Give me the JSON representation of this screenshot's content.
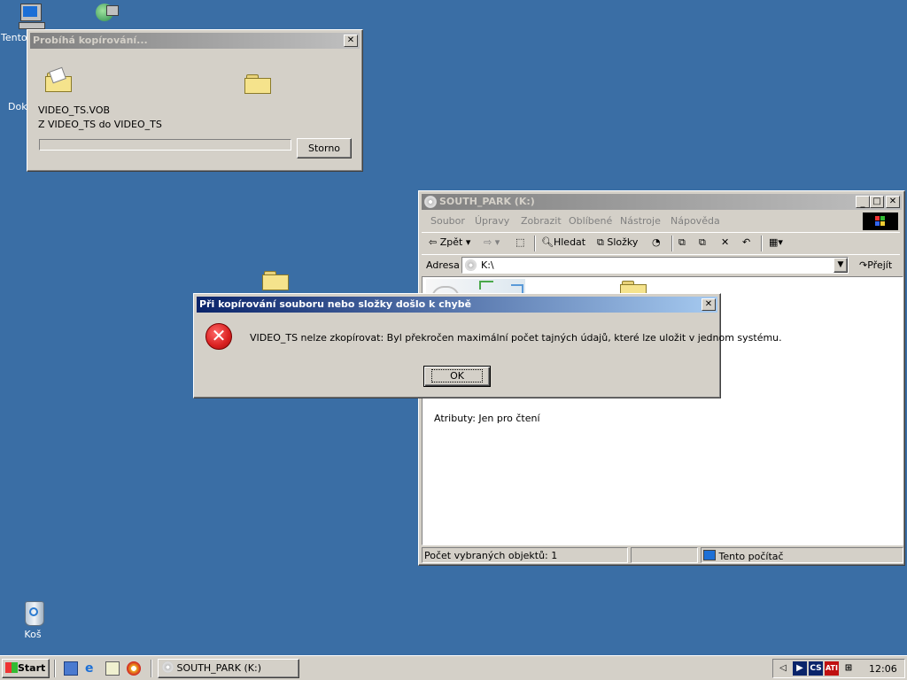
{
  "desktop": {
    "icons": [
      {
        "label": "Tento"
      },
      {
        "label": "Doku"
      },
      {
        "label": "Koš"
      }
    ]
  },
  "copy_dialog": {
    "title": "Probíhá kopírování...",
    "close": "✕",
    "file_name": "VIDEO_TS.VOB",
    "route": "Z VIDEO_TS do VIDEO_TS",
    "progress": 0,
    "cancel_label": "Storno"
  },
  "explorer": {
    "title": "SOUTH_PARK (K:)",
    "menu": [
      "Soubor",
      "Úpravy",
      "Zobrazit",
      "Oblíbené",
      "Nástroje",
      "Nápověda"
    ],
    "toolbar": {
      "back": "Zpět",
      "search": "Hledat",
      "folders": "Složky"
    },
    "address_label": "Adresa",
    "address_value": "K:\\",
    "go_label": "Přejít",
    "attributes": "Atributy: Jen pro čtení",
    "status": {
      "selected": "Počet vybraných objektů: 1",
      "computer": "Tento počítač"
    }
  },
  "error_dialog": {
    "title": "Při kopírování souboru nebo složky došlo k chybě",
    "close": "✕",
    "message": "VIDEO_TS nelze zkopírovat: Byl překročen maximální počet tajných údajů, které lze uložit v jednom systému.",
    "ok_label": "OK"
  },
  "taskbar": {
    "start_label": "Start",
    "task_label": "SOUTH_PARK (K:)",
    "clock": "12:06",
    "lang": "CS"
  },
  "colors": {
    "desktop": "#3a6ea5",
    "title_active": "#0a246a",
    "error_red": "#d92020"
  }
}
